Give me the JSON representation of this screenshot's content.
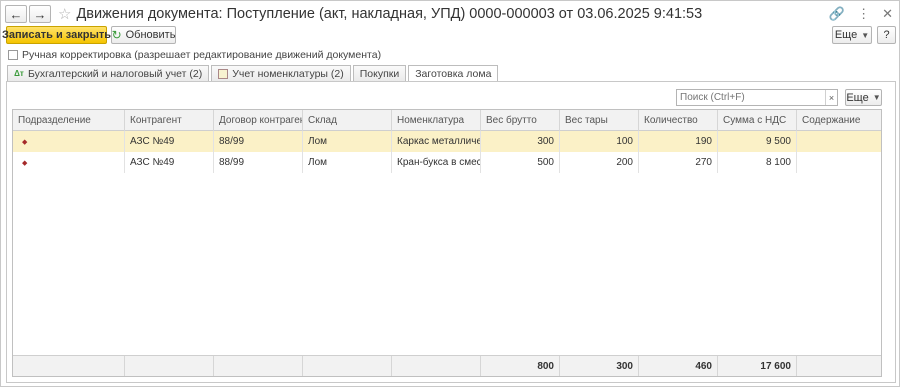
{
  "window": {
    "title": "Движения документа: Поступление (акт, накладная, УПД) 0000-000003 от 03.06.2025 9:41:53"
  },
  "nav": {
    "back_icon": "arrow-left",
    "forward_icon": "arrow-right",
    "favorite_icon": "star"
  },
  "toolbar": {
    "save_close_label": "Записать и закрыть",
    "refresh_label": "Обновить",
    "more_label": "Еще",
    "help_label": "?"
  },
  "manual_checkbox": {
    "label": "Ручная корректировка (разрешает редактирование движений документа)",
    "checked": false
  },
  "tabs": [
    {
      "label": "Бухгалтерский и налоговый учет (2)",
      "icon": "accounting-icon"
    },
    {
      "label": "Учет номенклатуры (2)",
      "icon": "register-icon"
    },
    {
      "label": "Покупки"
    },
    {
      "label": "Заготовка лома",
      "active": true
    }
  ],
  "search": {
    "placeholder": "Поиск (Ctrl+F)",
    "clear": "×",
    "more_label": "Еще"
  },
  "grid": {
    "columns": [
      "Подразделение",
      "Контрагент",
      "Договор контрагента",
      "Склад",
      "Номенклатура",
      "Вес брутто",
      "Вес тары",
      "Количество",
      "Сумма с НДС",
      "Содержание"
    ],
    "rows": [
      {
        "marker": "◆",
        "c1": "",
        "c2": "АЗС №49",
        "c3": "88/99",
        "c4": "Лом",
        "c5": "Каркас металличе...",
        "c6": "300",
        "c7": "100",
        "c8": "190",
        "c9": "9 500",
        "c10": ""
      },
      {
        "marker": "◆",
        "c1": "",
        "c2": "АЗС №49",
        "c3": "88/99",
        "c4": "Лом",
        "c5": "Кран-букса в смес...",
        "c6": "500",
        "c7": "200",
        "c8": "270",
        "c9": "8 100",
        "c10": ""
      }
    ],
    "totals": {
      "c6": "800",
      "c7": "300",
      "c8": "460",
      "c9": "17 600"
    }
  },
  "colors": {
    "primary_button": "#f5c400",
    "selected_row": "#fbf1c7",
    "active_tab_underline": "#d32f2f"
  }
}
